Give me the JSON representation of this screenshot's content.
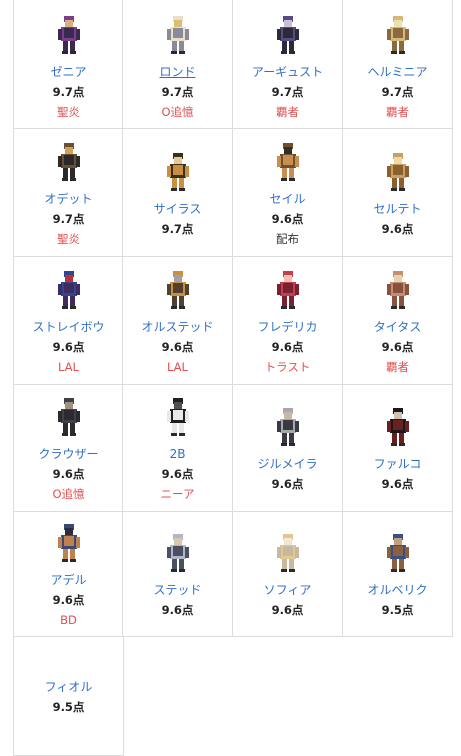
{
  "characters": [
    {
      "name": "ゼニア",
      "score": "9.7点",
      "tag": "聖炎",
      "underline": false,
      "tag_style": "red",
      "colors": [
        "#7a3d8c",
        "#3a2a50",
        "#d8b080"
      ]
    },
    {
      "name": "ロンド",
      "score": "9.7点",
      "tag": "O追憶",
      "underline": true,
      "tag_style": "red",
      "colors": [
        "#e8e0c8",
        "#8a8a9a",
        "#d8c070"
      ]
    },
    {
      "name": "アーギュスト",
      "score": "9.7点",
      "tag": "覇者",
      "underline": false,
      "tag_style": "red",
      "colors": [
        "#5a4a80",
        "#2a2a3a",
        "#c8c0d8"
      ]
    },
    {
      "name": "ヘルミニア",
      "score": "9.7点",
      "tag": "覇者",
      "underline": false,
      "tag_style": "red",
      "colors": [
        "#d8b878",
        "#8a6a40",
        "#f0e0b0"
      ]
    },
    {
      "name": "オデット",
      "score": "9.7点",
      "tag": "聖炎",
      "underline": false,
      "tag_style": "red",
      "colors": [
        "#6a5030",
        "#2a2a2a",
        "#d0a060"
      ]
    },
    {
      "name": "サイラス",
      "score": "9.7点",
      "tag": "",
      "underline": false,
      "tag_style": "red",
      "colors": [
        "#3a3020",
        "#c89040",
        "#e8c890"
      ]
    },
    {
      "name": "セイル",
      "score": "9.6点",
      "tag": "配布",
      "underline": false,
      "tag_style": "dark",
      "colors": [
        "#705030",
        "#c89050",
        "#30302a"
      ]
    },
    {
      "name": "セルテト",
      "score": "9.6点",
      "tag": "",
      "underline": false,
      "tag_style": "red",
      "colors": [
        "#c8a060",
        "#8a6030",
        "#f0d8a8"
      ]
    },
    {
      "name": "ストレイボウ",
      "score": "9.6点",
      "tag": "LAL",
      "underline": false,
      "tag_style": "red",
      "colors": [
        "#2a4a90",
        "#402a60",
        "#c03030"
      ]
    },
    {
      "name": "オルステッド",
      "score": "9.6点",
      "tag": "LAL",
      "underline": false,
      "tag_style": "red",
      "colors": [
        "#c89040",
        "#504030",
        "#a0a0b0"
      ]
    },
    {
      "name": "フレデリカ",
      "score": "9.6点",
      "tag": "トラスト",
      "underline": false,
      "tag_style": "red",
      "colors": [
        "#c04050",
        "#7a2030",
        "#f0c0b0"
      ]
    },
    {
      "name": "タイタス",
      "score": "9.6点",
      "tag": "覇者",
      "underline": false,
      "tag_style": "red",
      "colors": [
        "#c09070",
        "#8a5040",
        "#e8d0b0"
      ]
    },
    {
      "name": "クラウザー",
      "score": "9.6点",
      "tag": "O追憶",
      "underline": false,
      "tag_style": "red",
      "colors": [
        "#40404a",
        "#2a2a30",
        "#a09080"
      ]
    },
    {
      "name": "2B",
      "score": "9.6点",
      "tag": "ニーア",
      "underline": false,
      "tag_style": "red",
      "colors": [
        "#202020",
        "#e8e8e8",
        "#505050"
      ]
    },
    {
      "name": "ジルメイラ",
      "score": "9.6点",
      "tag": "",
      "underline": false,
      "tag_style": "red",
      "colors": [
        "#a8a8b0",
        "#3a3a40",
        "#c8b8a8"
      ]
    },
    {
      "name": "ファルコ",
      "score": "9.6点",
      "tag": "",
      "underline": false,
      "tag_style": "red",
      "colors": [
        "#1a1a1a",
        "#6a2020",
        "#d0c0b0"
      ]
    },
    {
      "name": "アデル",
      "score": "9.6点",
      "tag": "BD",
      "underline": false,
      "tag_style": "red",
      "colors": [
        "#3a4a70",
        "#c08050",
        "#2a2a40"
      ]
    },
    {
      "name": "ステッド",
      "score": "9.6点",
      "tag": "",
      "underline": false,
      "tag_style": "red",
      "colors": [
        "#b0b8c8",
        "#4a5060",
        "#d8c8b0"
      ]
    },
    {
      "name": "ソフィア",
      "score": "9.6点",
      "tag": "",
      "underline": false,
      "tag_style": "red",
      "colors": [
        "#e0c890",
        "#c8b8a0",
        "#f0e8d0"
      ]
    },
    {
      "name": "オルベリク",
      "score": "9.5点",
      "tag": "",
      "underline": false,
      "tag_style": "red",
      "colors": [
        "#3a5080",
        "#8a6040",
        "#c0a080"
      ]
    },
    {
      "name": "フィオル",
      "score": "9.5点",
      "tag": "",
      "underline": false,
      "tag_style": "red",
      "colors": [
        "#ffffff",
        "#ffffff",
        "#ffffff"
      ],
      "no_sprite": true
    }
  ]
}
